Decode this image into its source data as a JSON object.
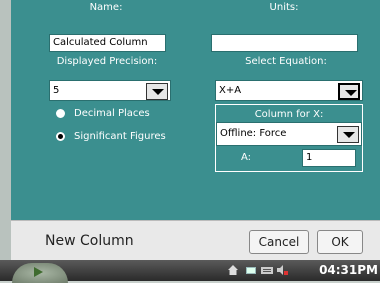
{
  "form": {
    "name_label": "Name:",
    "name_value": "Calculated Column",
    "units_label": "Units:",
    "units_value": "",
    "precision_label": "Displayed Precision:",
    "precision_value": "5",
    "equation_label": "Select Equation:",
    "equation_value": "X+A",
    "precision_modes": [
      {
        "label": "Decimal Places",
        "selected": false
      },
      {
        "label": "Significant Figures",
        "selected": true
      }
    ],
    "column_x_label": "Column for X:",
    "column_x_value": "Offline: Force",
    "a_label": "A:",
    "a_value": "1"
  },
  "footer": {
    "title": "New Column",
    "cancel_label": "Cancel",
    "ok_label": "OK"
  },
  "taskbar": {
    "clock": "04:31PM"
  }
}
